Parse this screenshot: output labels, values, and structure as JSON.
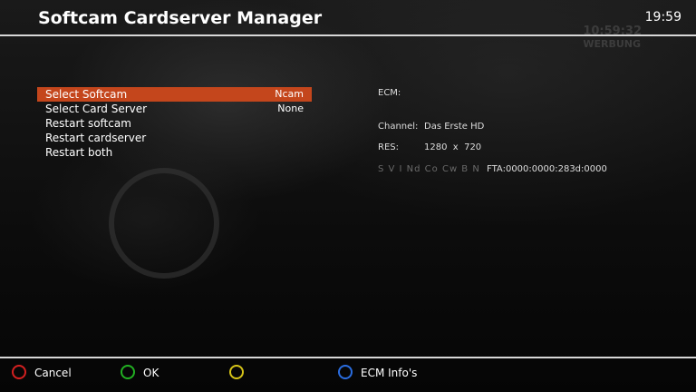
{
  "header": {
    "title": "Softcam Cardserver Manager",
    "clock": "19:59",
    "background_overlay_time": "10:59:32",
    "background_overlay_text": "WERBUNG"
  },
  "menu": {
    "items": [
      {
        "label": "Select Softcam",
        "value": "Ncam",
        "selected": true
      },
      {
        "label": "Select Card Server",
        "value": "None",
        "selected": false
      },
      {
        "label": "Restart softcam",
        "value": "",
        "selected": false
      },
      {
        "label": "Restart cardserver",
        "value": "",
        "selected": false
      },
      {
        "label": "Restart both",
        "value": "",
        "selected": false
      }
    ]
  },
  "info": {
    "ecm_label": "ECM:",
    "channel_label": "Channel:",
    "channel_value": "Das Erste HD",
    "res_label": "RES:",
    "res_value": "1280  x  720",
    "caid_flags": "S V I Nd Co Cw B N",
    "caid_value": "FTA:0000:0000:283d:0000"
  },
  "footer": {
    "buttons": [
      {
        "label": "Cancel",
        "color": "#d42020",
        "icon": "red-circle-icon"
      },
      {
        "label": "OK",
        "color": "#22b022",
        "icon": "green-circle-icon"
      },
      {
        "label": "",
        "color": "#d6c418",
        "icon": "yellow-circle-icon"
      },
      {
        "label": "ECM Info's",
        "color": "#2a6de0",
        "icon": "blue-circle-icon"
      }
    ]
  }
}
